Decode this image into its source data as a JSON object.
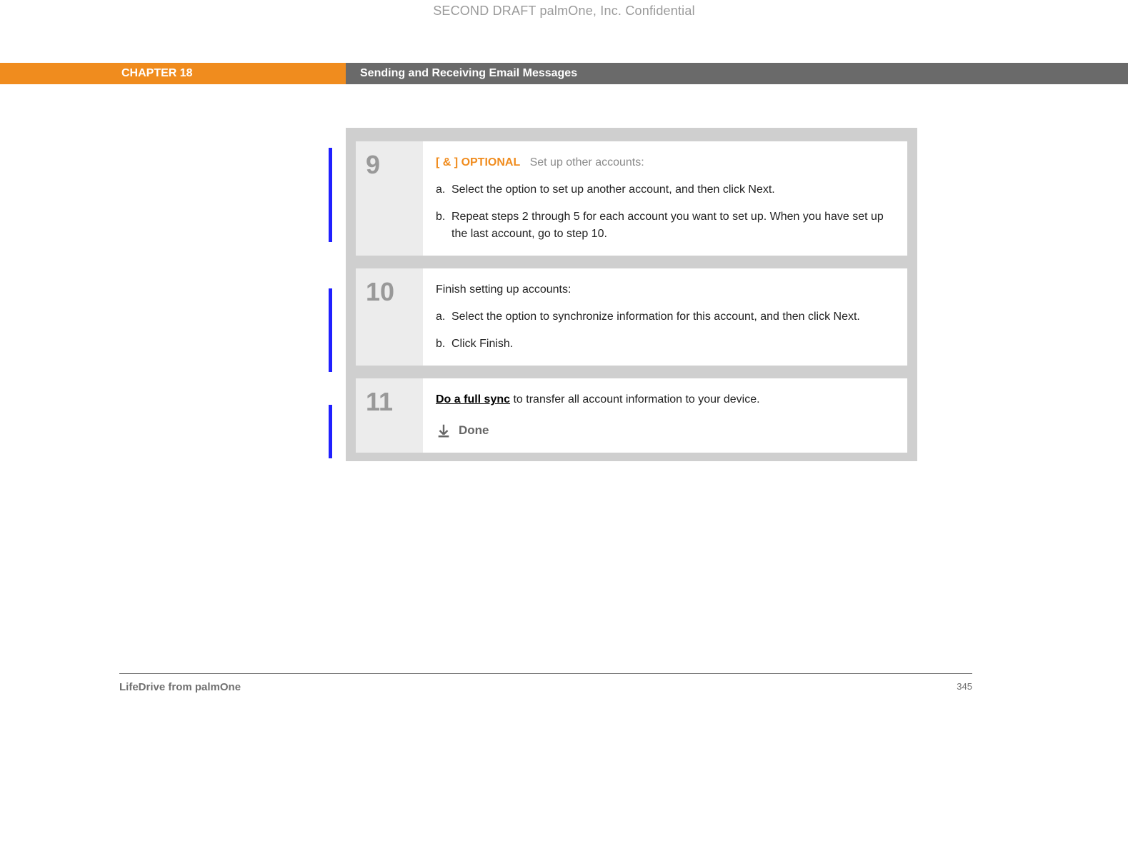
{
  "draft_header": "SECOND DRAFT palmOne, Inc.  Confidential",
  "chapter": {
    "label": "CHAPTER 18",
    "title": "Sending and Receiving Email Messages"
  },
  "steps": [
    {
      "number": "9",
      "optional_prefix": "[ & ]",
      "optional_word": "OPTIONAL",
      "intro": "Set up other accounts:",
      "items": [
        {
          "letter": "a.",
          "text": "Select the option to set up another account, and then click Next."
        },
        {
          "letter": "b.",
          "text": "Repeat steps 2 through 5 for each account you want to set up. When you have set up the last account, go to step 10."
        }
      ]
    },
    {
      "number": "10",
      "intro": "Finish setting up accounts:",
      "items": [
        {
          "letter": "a.",
          "text": "Select the option to synchronize information for this account, and then click Next."
        },
        {
          "letter": "b.",
          "text": "Click Finish."
        }
      ]
    },
    {
      "number": "11",
      "link": "Do a full sync",
      "rest": " to transfer all account information to your device.",
      "done": "Done"
    }
  ],
  "footer": {
    "left": "LifeDrive from palmOne",
    "right": "345"
  }
}
